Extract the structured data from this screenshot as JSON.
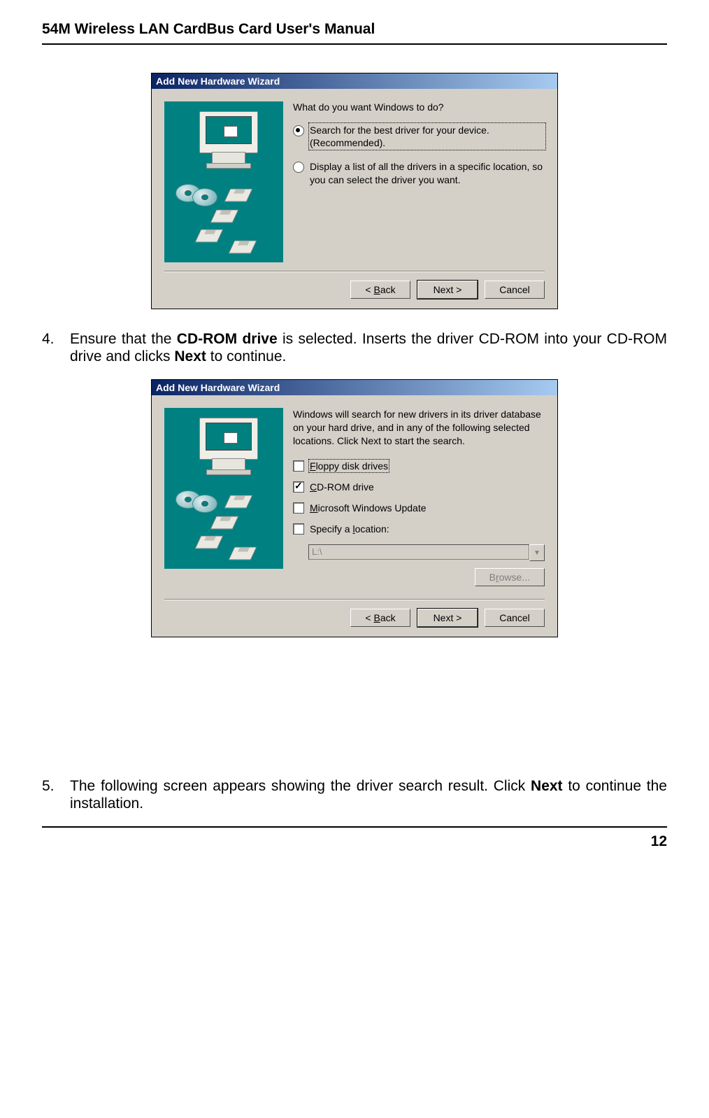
{
  "header": {
    "title": "54M Wireless LAN CardBus Card User's Manual"
  },
  "dialog1": {
    "title": "Add New Hardware Wizard",
    "question": "What do you want Windows to do?",
    "option1": "Search for the best driver for your device. (Recommended).",
    "option2": "Display a list of all the drivers in a specific location, so you can select the driver you want.",
    "back": "< Back",
    "next": "Next >",
    "cancel": "Cancel"
  },
  "step4": {
    "num": "4.",
    "pre": "Ensure that the ",
    "b1": "CD-ROM drive",
    "mid": " is selected. Inserts the driver CD-ROM into your CD-ROM drive and clicks ",
    "b2": "Next",
    "post": " to continue."
  },
  "dialog2": {
    "title": "Add New Hardware Wizard",
    "info": "Windows will search for new drivers in its driver database on your hard drive, and in any of the following selected locations. Click Next to start the search.",
    "floppy": "Floppy disk drives",
    "cdrom": "CD-ROM drive",
    "update": "Microsoft Windows Update",
    "specify": "Specify a location:",
    "location_value": "L:\\",
    "browse": "Browse...",
    "back": "< Back",
    "next": "Next >",
    "cancel": "Cancel"
  },
  "step5": {
    "num": "5.",
    "pre": "The following screen appears showing the driver search result. Click ",
    "b1": "Next",
    "post": " to continue the installation."
  },
  "page_num": "12"
}
